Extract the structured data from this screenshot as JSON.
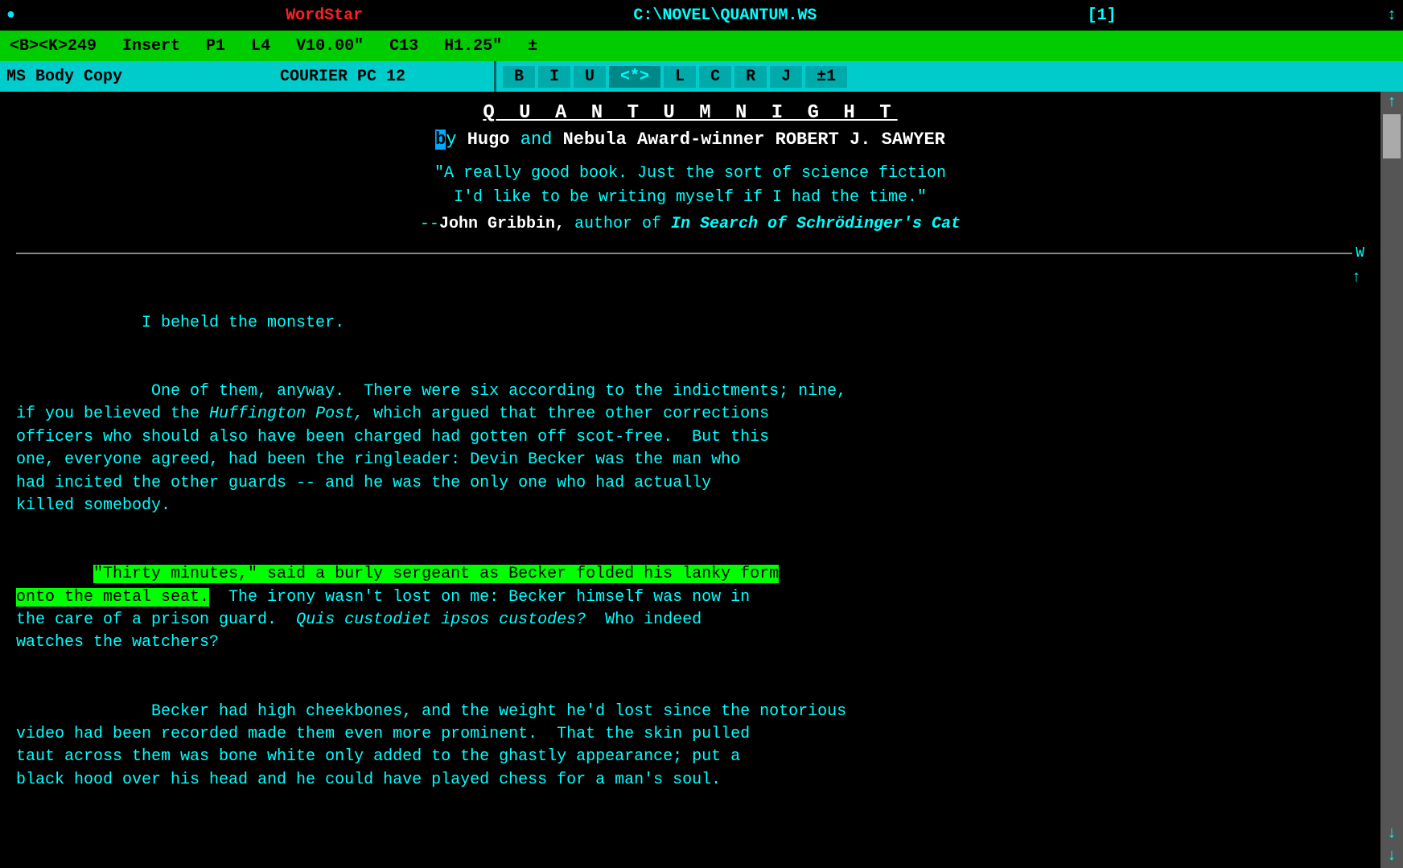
{
  "titlebar": {
    "dot": "●",
    "app_name": "WordStar",
    "file_path": "C:\\NOVEL\\QUANTUM.WS",
    "page_indicator": "[1]",
    "scroll_arrow": "↕"
  },
  "statusbar": {
    "position": "<B><K>249",
    "mode": "Insert",
    "page": "P1",
    "line": "L4",
    "v_pos": "V10.00\"",
    "col": "C13",
    "h_pos": "H1.25\"",
    "plus": "±"
  },
  "toolbar": {
    "style": "MS Body Copy",
    "font": "COURIER PC 12",
    "btn_b": "B",
    "btn_i": "I",
    "btn_u": "U",
    "btn_special": "<*>",
    "btn_l": "L",
    "btn_c": "C",
    "btn_r": "R",
    "btn_j": "J",
    "btn_spacing": "±1"
  },
  "document": {
    "title": "Q U A N T U M   N I G H T",
    "subtitle_by": "by",
    "subtitle_awards": "Hugo",
    "subtitle_and": "and",
    "subtitle_nebula": "Nebula Award",
    "subtitle_winner": "-winner",
    "subtitle_author": "ROBERT J. SAWYER",
    "subtitle_cursor": "b",
    "quote_line1": "\"A really good book.  Just the sort of science fiction",
    "quote_line2": "I'd like to be writing myself if I had the time.\"",
    "attribution_dash": "--",
    "attribution_name": "John Gribbin,",
    "attribution_role": "author",
    "attribution_of": "of",
    "attribution_book": "In Search of Schrödinger's Cat",
    "body_paragraph1": "     I beheld the monster.",
    "body_paragraph2": "      One of them, anyway.  There were six according to the indictments; nine,\nif you believed the ",
    "body_huffpost": "Huffington Post,",
    "body_paragraph2b": " which argued that three other corrections\nofficers who should also have been charged had gotten off scot-free.  But this\none, everyone agreed, had been the ringleader: Devin Becker was the man who\nhad incited the other guards -- and he was the only one who had actually\nkilled somebody.",
    "body_highlight1": "\"Thirty minutes,\" said a burly sergeant as Becker folded his lanky form\nonto the metal seat.",
    "body_paragraph3": "  The irony wasn't lost on me: Becker himself was now in\nthe care of a prison guard.  ",
    "body_latin": "Quis custodiet ipsos custodes?",
    "body_paragraph3b": "  Who indeed\nwatches the watchers?",
    "body_paragraph4": "      Becker had high cheekbones, and the weight he'd lost since the notorious\nvideo had been recorded made them even more prominent.  That the skin pulled\ntaut across them was bone white only added to the ghastly appearance; put a\nblack hood over his head and he could have played chess for a man's soul."
  },
  "scrollbar": {
    "arrow_up": "↑",
    "thumb": "",
    "arrow_down": "↓",
    "arrow_down2": "↓",
    "w_marker": "W"
  }
}
